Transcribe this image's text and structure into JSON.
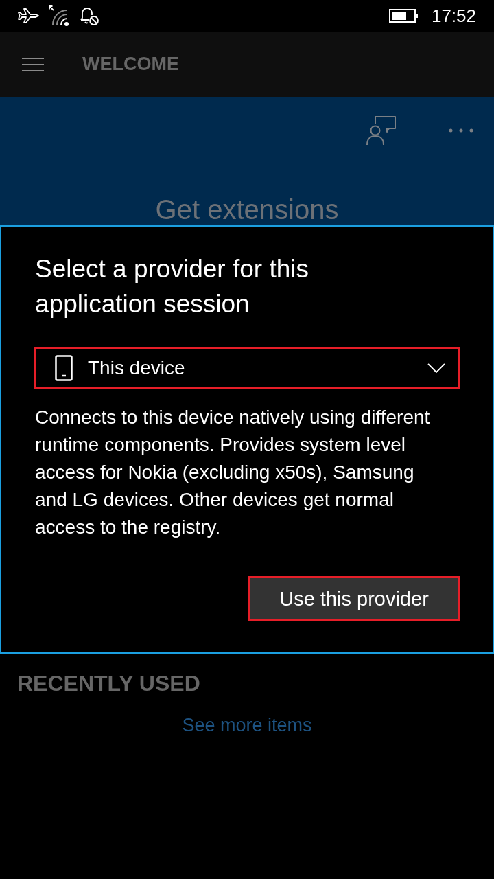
{
  "status_bar": {
    "time": "17:52"
  },
  "app_bar": {
    "title": "WELCOME"
  },
  "header": {
    "title": "Get extensions"
  },
  "dialog": {
    "title": "Select a provider for this application session",
    "provider_select": {
      "value": "This device"
    },
    "description": "Connects to this device natively using different runtime components. Provides system level access for Nokia (excluding x50s), Samsung and LG devices. Other devices get normal access to the registry.",
    "button": "Use this provider"
  },
  "recently_used": {
    "heading": "RECENTLY USED",
    "link": "See more items"
  }
}
